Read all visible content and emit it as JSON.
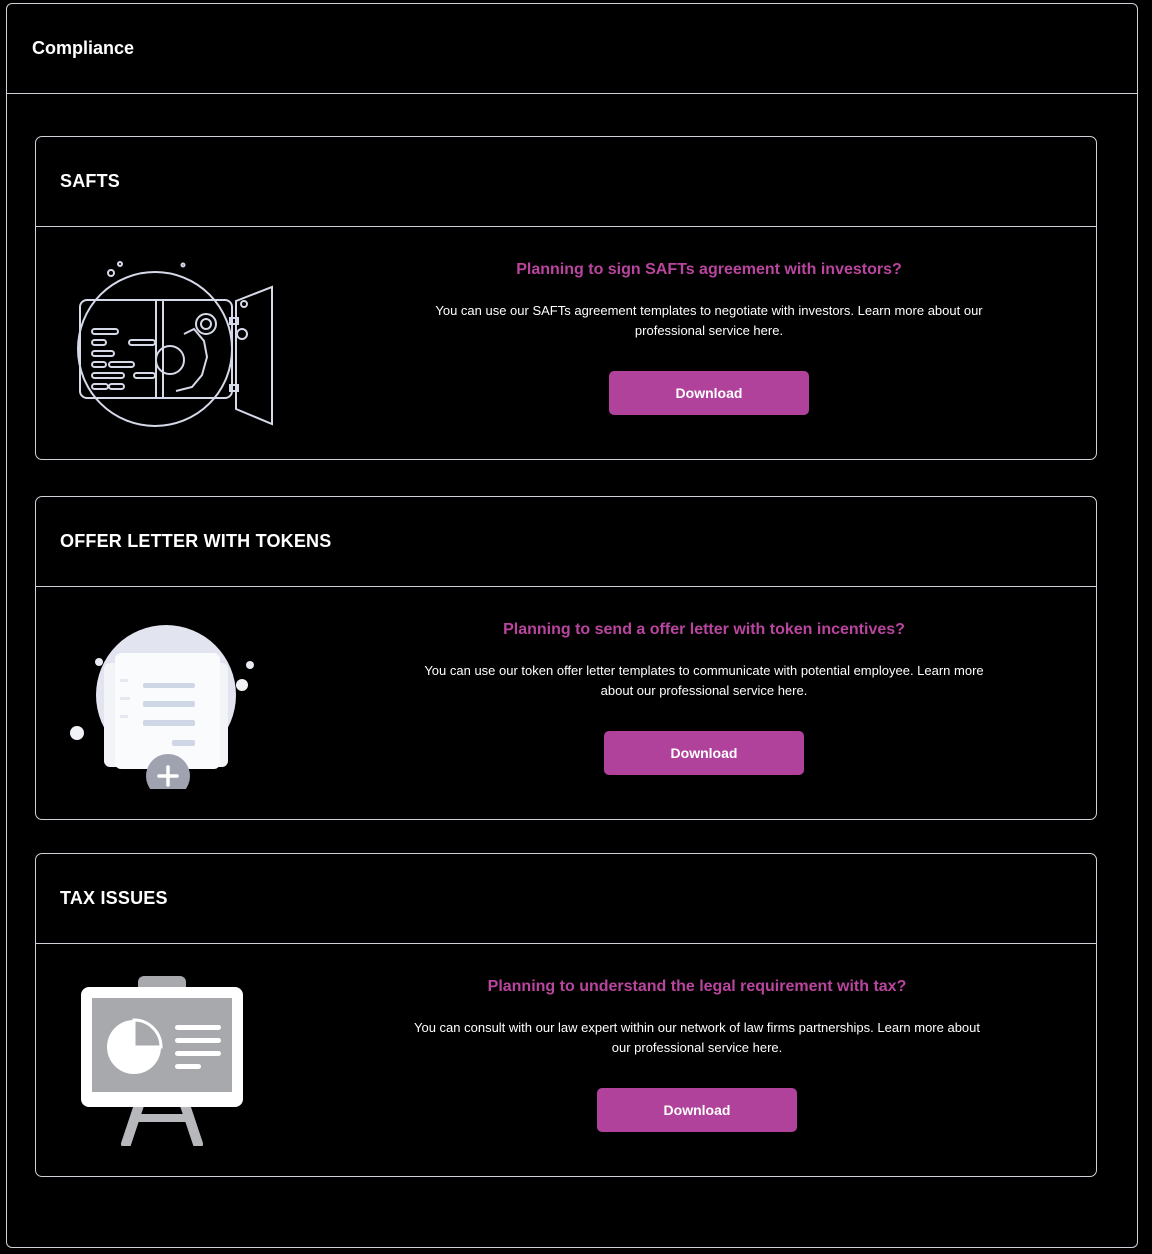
{
  "page": {
    "title": "Compliance"
  },
  "colors": {
    "accent": "#b1429c",
    "headline": "#b9459e",
    "background": "#000000",
    "border": "#cfd1d8"
  },
  "cards": [
    {
      "title": "SAFTS",
      "icon": "safe-vault-icon",
      "headline": "Planning to sign SAFTs agreement with investors?",
      "description": "You can use our SAFTs agreement templates to negotiate with investors. Learn more about our professional service here.",
      "button_label": "Download"
    },
    {
      "title": "OFFER LETTER WITH TOKENS",
      "icon": "document-add-icon",
      "headline": "Planning to send a offer letter with token incentives?",
      "description": "You can use our token offer letter templates to communicate with potential employee. Learn more about our professional service here.",
      "button_label": "Download"
    },
    {
      "title": "TAX ISSUES",
      "icon": "presentation-board-icon",
      "headline": "Planning to understand the legal requirement with tax?",
      "description": "You can consult with our law expert within our network of law firms partnerships. Learn more about our professional service here.",
      "button_label": "Download"
    }
  ]
}
